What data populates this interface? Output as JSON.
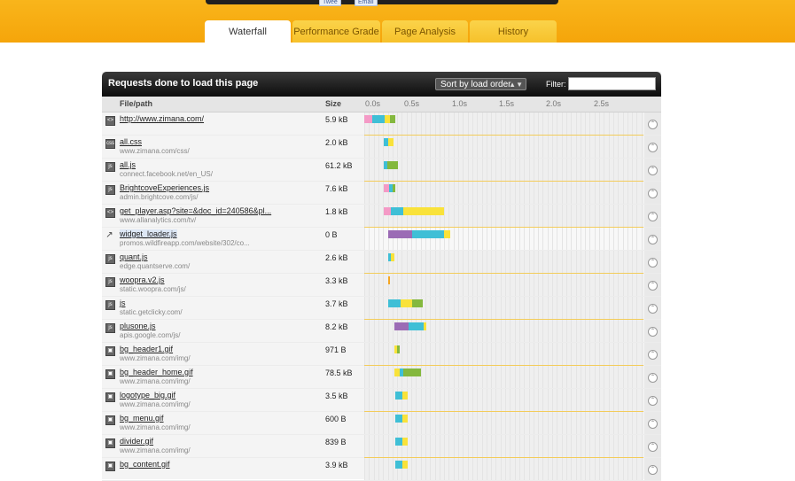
{
  "share": {
    "tweet": "Twee",
    "email": "Email"
  },
  "tabs": [
    {
      "label": "Waterfall",
      "active": true
    },
    {
      "label": "Performance Grade",
      "active": false
    },
    {
      "label": "Page Analysis",
      "active": false
    },
    {
      "label": "History",
      "active": false
    }
  ],
  "panel": {
    "title": "Requests done to load this page",
    "sort_label": "Sort by load order",
    "filter_label": "Filter:",
    "filter_value": ""
  },
  "columns": {
    "file": "File/path",
    "size": "Size"
  },
  "time_ticks": [
    "0.0s",
    "0.5s",
    "1.0s",
    "1.5s",
    "2.0s",
    "2.5s"
  ],
  "colors": {
    "pink": "#f49ac6",
    "purple": "#9b6bb5",
    "cyan": "#3fbfd6",
    "yellow": "#f9e23a",
    "green": "#84b83e",
    "orange": "#f5a623",
    "accent": "#f5a50a"
  },
  "rows": [
    {
      "name": "http://www.zimana.com/",
      "host": "",
      "size": "5.9 kB",
      "icon": "html-file-icon",
      "bars": [
        [
          0,
          9,
          "pink"
        ],
        [
          9,
          14,
          "cyan"
        ],
        [
          23,
          6,
          "yellow"
        ],
        [
          29,
          6,
          "green"
        ]
      ]
    },
    {
      "name": "all.css",
      "host": "www.zimana.com/css/",
      "size": "2.0 kB",
      "icon": "css-file-icon",
      "bars": [
        [
          22,
          5,
          "cyan"
        ],
        [
          27,
          6,
          "yellow"
        ]
      ]
    },
    {
      "name": "all.js",
      "host": "connect.facebook.net/en_US/",
      "size": "61.2 kB",
      "icon": "script-file-icon",
      "bars": [
        [
          22,
          4,
          "cyan"
        ],
        [
          26,
          12,
          "green"
        ]
      ]
    },
    {
      "name": "BrightcoveExperiences.js",
      "host": "admin.brightcove.com/js/",
      "size": "7.6 kB",
      "icon": "script-file-icon",
      "bars": [
        [
          22,
          6,
          "pink"
        ],
        [
          28,
          4,
          "cyan"
        ],
        [
          32,
          3,
          "green"
        ]
      ]
    },
    {
      "name": "get_player.asp?site=&doc_id=240586&pl...",
      "host": "www.allanalytics.com/tv/",
      "size": "1.8 kB",
      "icon": "html-file-icon",
      "bars": [
        [
          22,
          8,
          "pink"
        ],
        [
          30,
          14,
          "cyan"
        ],
        [
          44,
          46,
          "yellow"
        ]
      ]
    },
    {
      "name": "widget_loader.js",
      "host": "promos.wildfireapp.com/website/302/co...",
      "size": "0 B",
      "icon": "redirect-icon",
      "current": true,
      "bars": [
        [
          27,
          27,
          "purple"
        ],
        [
          54,
          36,
          "cyan"
        ],
        [
          90,
          7,
          "yellow"
        ]
      ]
    },
    {
      "name": "quant.js",
      "host": "edge.quantserve.com/",
      "size": "2.6 kB",
      "icon": "script-file-icon",
      "bars": [
        [
          27,
          3,
          "cyan"
        ],
        [
          30,
          4,
          "yellow"
        ]
      ]
    },
    {
      "name": "woopra.v2.js",
      "host": "static.woopra.com/js/",
      "size": "3.3 kB",
      "icon": "script-file-icon",
      "bars": [
        [
          27,
          2,
          "orange"
        ]
      ]
    },
    {
      "name": "js",
      "host": "static.getclicky.com/",
      "size": "3.7 kB",
      "icon": "script-file-icon",
      "bars": [
        [
          27,
          14,
          "cyan"
        ],
        [
          41,
          13,
          "yellow"
        ],
        [
          54,
          12,
          "green"
        ]
      ]
    },
    {
      "name": "plusone.js",
      "host": "apis.google.com/js/",
      "size": "8.2 kB",
      "icon": "script-file-icon",
      "bars": [
        [
          34,
          16,
          "purple"
        ],
        [
          50,
          17,
          "cyan"
        ],
        [
          67,
          3,
          "yellow"
        ]
      ]
    },
    {
      "name": "bg_header1.gif",
      "host": "www.zimana.com/img/",
      "size": "971 B",
      "icon": "image-file-icon",
      "bars": [
        [
          34,
          3,
          "yellow"
        ],
        [
          37,
          3,
          "green"
        ]
      ]
    },
    {
      "name": "bg_header_home.gif",
      "host": "www.zimana.com/img/",
      "size": "78.5 kB",
      "icon": "image-file-icon",
      "bars": [
        [
          34,
          6,
          "yellow"
        ],
        [
          40,
          4,
          "cyan"
        ],
        [
          44,
          20,
          "green"
        ]
      ]
    },
    {
      "name": "logotype_big.gif",
      "host": "www.zimana.com/img/",
      "size": "3.5 kB",
      "icon": "image-file-icon",
      "bars": [
        [
          35,
          8,
          "cyan"
        ],
        [
          43,
          6,
          "yellow"
        ]
      ]
    },
    {
      "name": "bg_menu.gif",
      "host": "www.zimana.com/img/",
      "size": "600 B",
      "icon": "image-file-icon",
      "bars": [
        [
          35,
          8,
          "cyan"
        ],
        [
          43,
          6,
          "yellow"
        ]
      ]
    },
    {
      "name": "divider.gif",
      "host": "www.zimana.com/img/",
      "size": "839 B",
      "icon": "image-file-icon",
      "bars": [
        [
          35,
          8,
          "cyan"
        ],
        [
          43,
          6,
          "yellow"
        ]
      ]
    },
    {
      "name": "bg_content.gif",
      "host": "",
      "size": "3.9 kB",
      "icon": "image-file-icon",
      "bars": [
        [
          35,
          8,
          "cyan"
        ],
        [
          43,
          6,
          "yellow"
        ]
      ]
    }
  ]
}
